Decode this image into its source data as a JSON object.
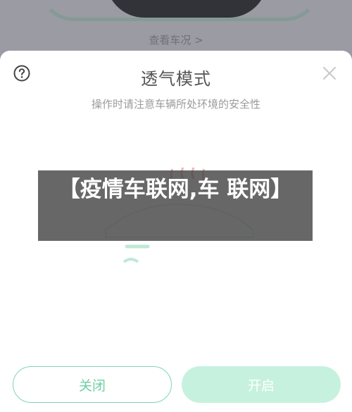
{
  "background": {
    "view_car_status_label": "查看车况 >"
  },
  "sheet": {
    "title": "透气模式",
    "subtitle": "操作时请注意车辆所处环境的安全性",
    "help_icon": "help-circle-icon",
    "close_icon": "close-icon",
    "buttons": {
      "off_label": "关闭",
      "on_label": "开启"
    }
  },
  "watermark": {
    "text": "【疫情车联网,车 联网】"
  },
  "colors": {
    "accent_green": "#6fcfa6",
    "accent_green_light": "#c6f1de",
    "banner_bg": "#464646"
  }
}
